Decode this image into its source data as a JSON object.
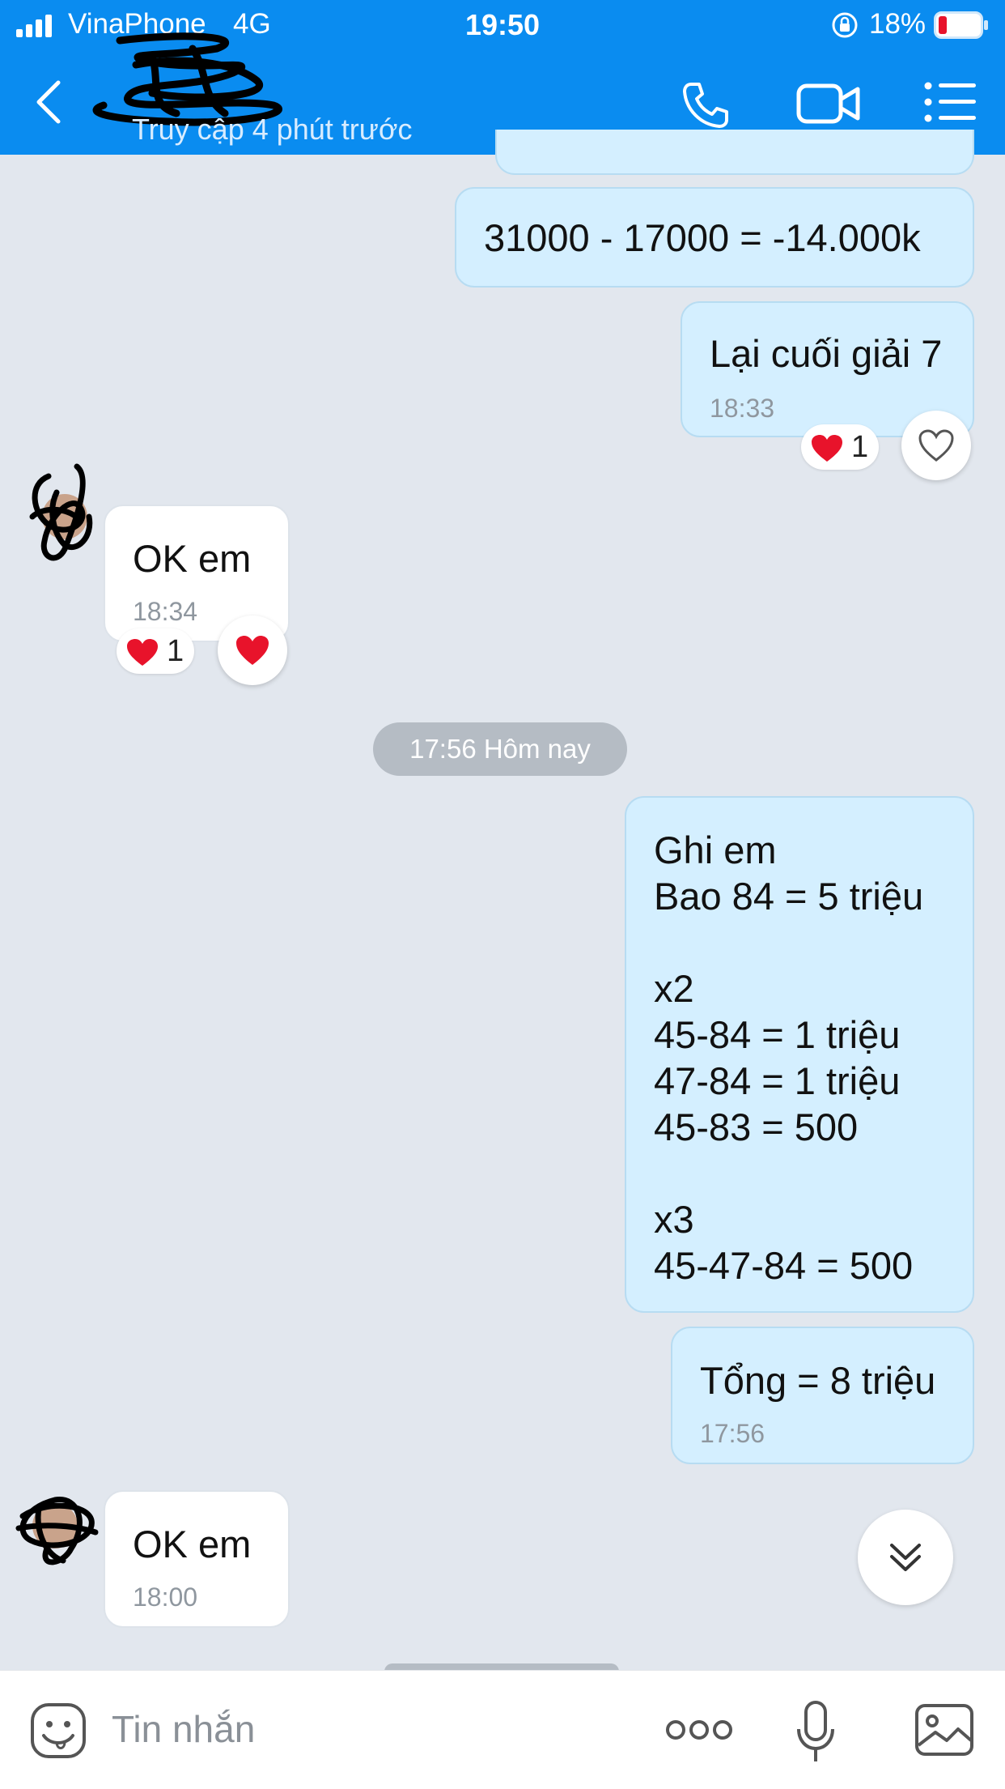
{
  "status_bar": {
    "carrier": "VinaPhone",
    "network": "4G",
    "time": "19:50",
    "battery": "18%"
  },
  "header": {
    "last_seen": "Truy cập 4 phút trước",
    "icons": [
      "back-icon",
      "call-icon",
      "video-icon",
      "menu-icon"
    ]
  },
  "messages": [
    {
      "sender": "me",
      "text": "31000 - 17000 = -14.000k"
    },
    {
      "sender": "me",
      "text": "Lại cuối giải 7",
      "time": "18:33",
      "reaction_count": "1"
    },
    {
      "sender": "them",
      "text": "OK em",
      "time": "18:34",
      "reaction_count": "1"
    },
    {
      "sender": "me",
      "text": "Ghi em\nBao 84 = 5 triệu\n\nx2\n45-84 = 1 triệu\n47-84 = 1 triệu\n45-83 = 500\n\nx3\n45-47-84 = 500"
    },
    {
      "sender": "me",
      "text": "Tổng = 8 triệu",
      "time": "17:56"
    },
    {
      "sender": "them",
      "text": "OK em",
      "time": "18:00"
    }
  ],
  "date_divider": "17:56 Hôm nay",
  "input": {
    "placeholder": "Tin nhắn"
  },
  "colors": {
    "header": "#0a8cf0",
    "my_bubble": "#d4efff",
    "their_bubble": "#ffffff",
    "background": "#e2e7ee",
    "heart": "#e8132b"
  }
}
